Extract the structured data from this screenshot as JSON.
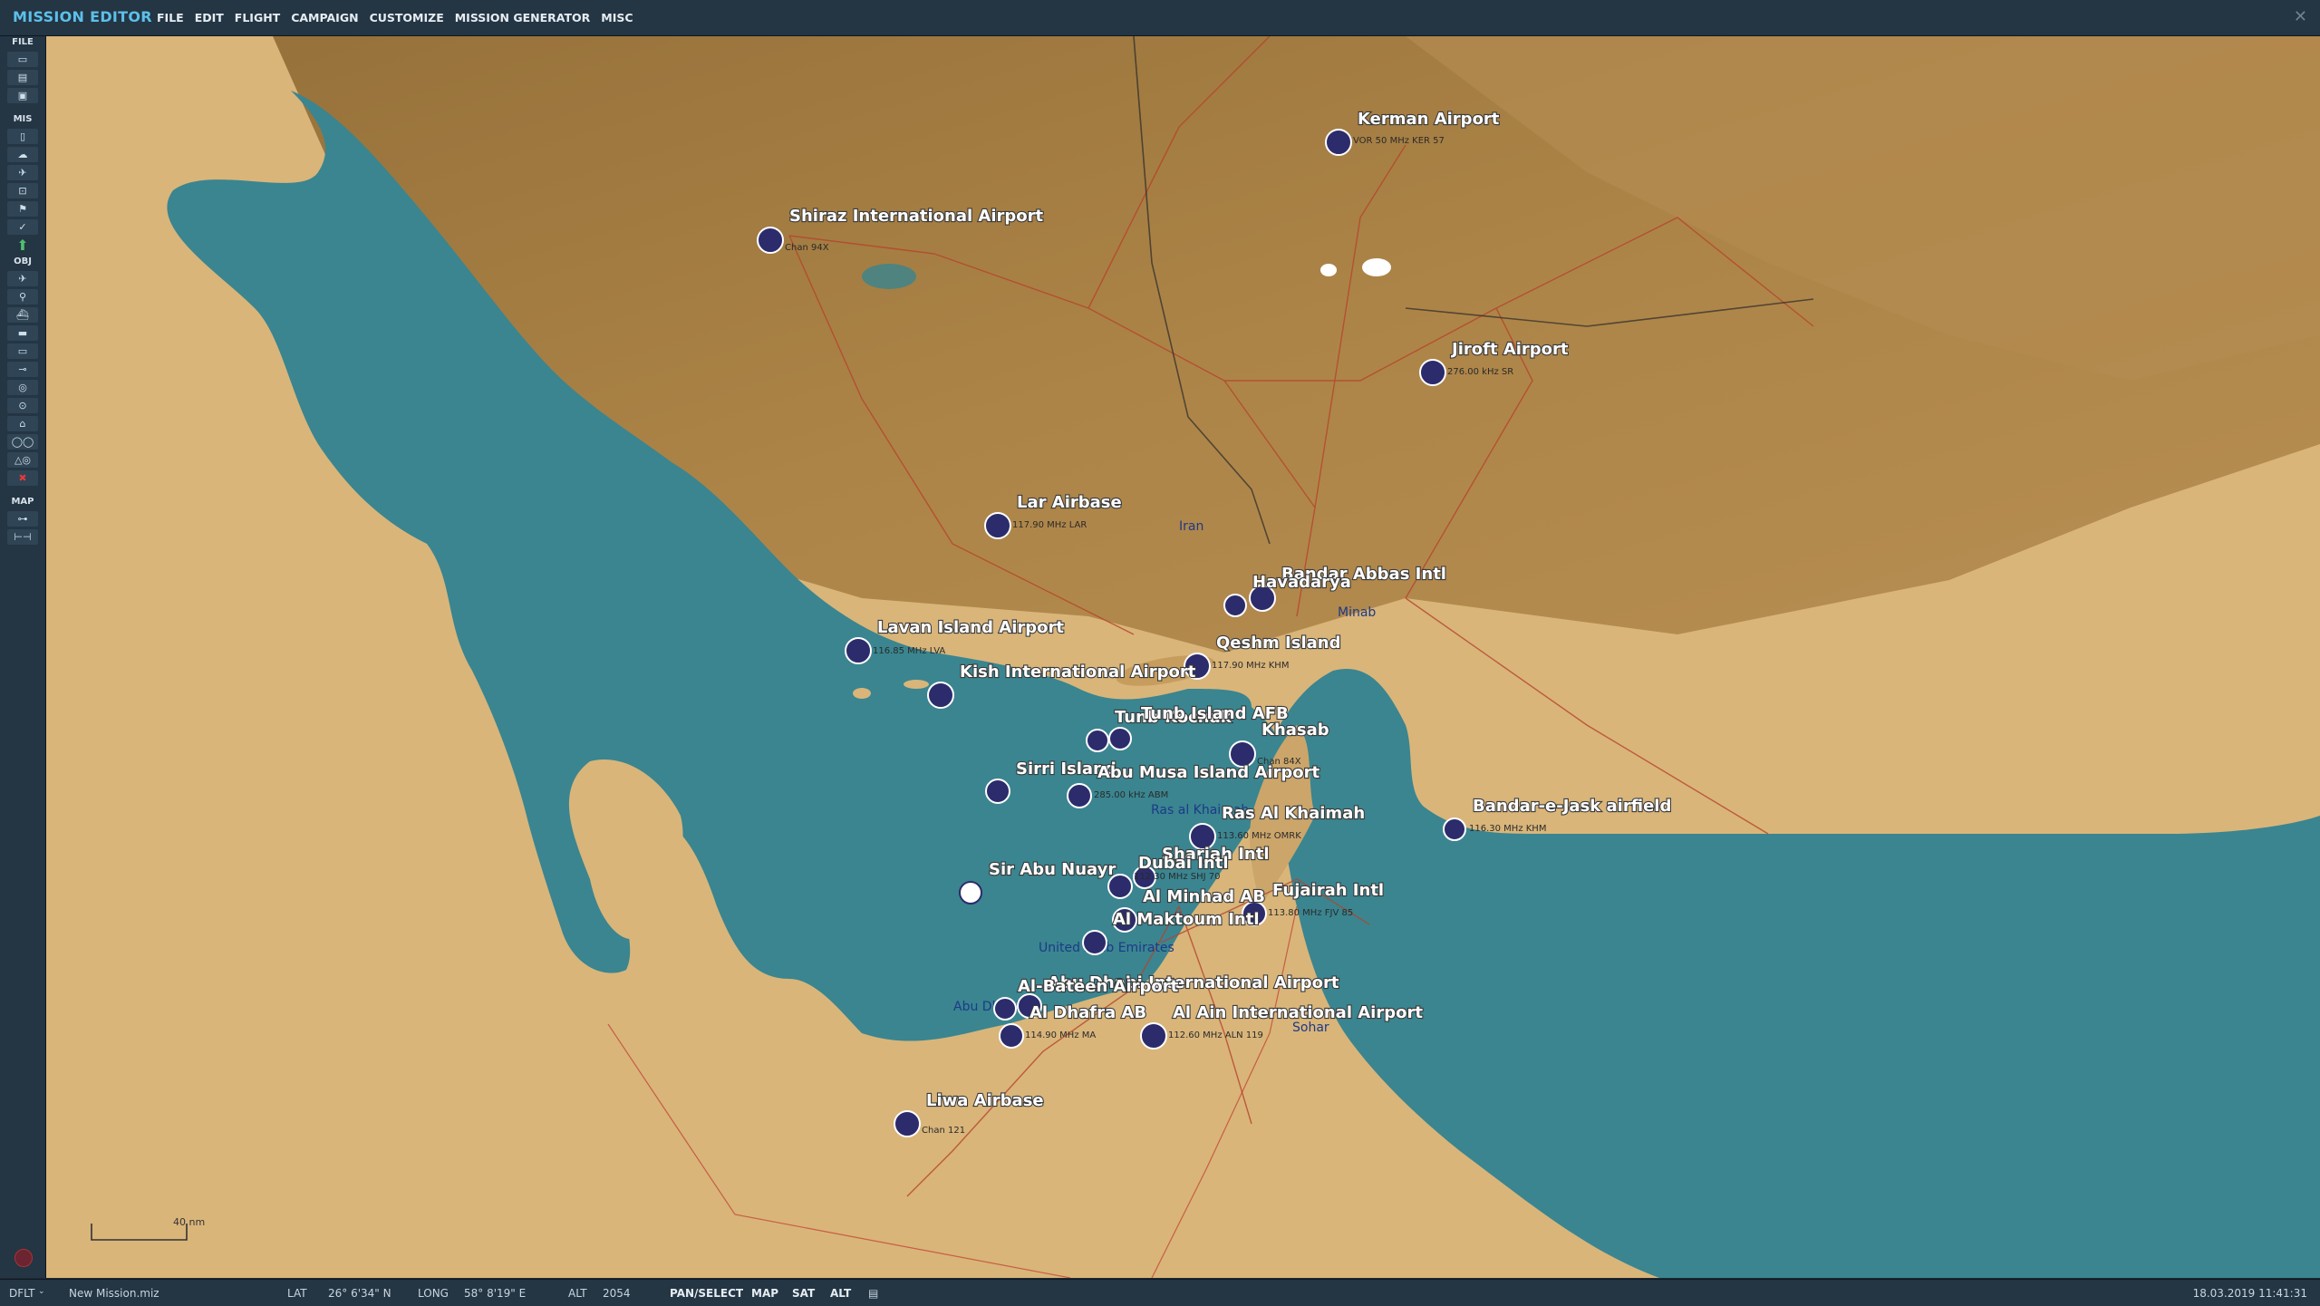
{
  "app": {
    "title": "MISSION EDITOR"
  },
  "menu": [
    "FILE",
    "EDIT",
    "FLIGHT",
    "CAMPAIGN",
    "CUSTOMIZE",
    "MISSION GENERATOR",
    "MISC"
  ],
  "sidebar": {
    "sections": {
      "file": "FILE",
      "mis": "MIS",
      "obj": "OBJ",
      "map": "MAP"
    }
  },
  "map": {
    "airports": [
      {
        "name": "Kerman Airport",
        "freq": "VOR 50 MHz KER 57"
      },
      {
        "name": "Shiraz International Airport",
        "freq": "Chan 94X"
      },
      {
        "name": "Jiroft Airport",
        "freq": "276.00 kHz SR"
      },
      {
        "name": "Lar Airbase",
        "freq": "117.90 MHz LAR"
      },
      {
        "name": "Bandar Abbas Intl",
        "freq": ""
      },
      {
        "name": "Havadarya",
        "freq": ""
      },
      {
        "name": "Lavan Island Airport",
        "freq": "116.85 MHz LVA"
      },
      {
        "name": "Qeshm Island",
        "freq": "117.90 MHz KHM"
      },
      {
        "name": "Kish International Airport",
        "freq": ""
      },
      {
        "name": "Tunb Kochak",
        "freq": ""
      },
      {
        "name": "Tunb Island AFB",
        "freq": ""
      },
      {
        "name": "Khasab",
        "freq": "Chan 84X"
      },
      {
        "name": "Sirri Island",
        "freq": ""
      },
      {
        "name": "Abu Musa Island Airport",
        "freq": "285.00 kHz ABM"
      },
      {
        "name": "Ras Al Khaimah",
        "freq": "113.60 MHz OMRK"
      },
      {
        "name": "Bandar-e-Jask airfield",
        "freq": "116.30 MHz KHM"
      },
      {
        "name": "Sharjah Intl",
        "freq": ""
      },
      {
        "name": "Sir Abu Nuayr",
        "freq": ""
      },
      {
        "name": "Dubai Intl",
        "freq": "112.30 MHz SHJ 70"
      },
      {
        "name": "Fujairah Intl",
        "freq": "113.80 MHz FJV 85"
      },
      {
        "name": "Al Minhad AB",
        "freq": ""
      },
      {
        "name": "Al Maktoum Intl",
        "freq": ""
      },
      {
        "name": "Abu Dhabi International Airport",
        "freq": ""
      },
      {
        "name": "Al-Bateen Airport",
        "freq": ""
      },
      {
        "name": "Al Dhafra AB",
        "freq": "114.90 MHz MA"
      },
      {
        "name": "Al Ain International Airport",
        "freq": "112.60 MHz ALN 119"
      },
      {
        "name": "Liwa Airbase",
        "freq": "Chan 121"
      }
    ],
    "places": [
      "Iran",
      "Minab",
      "United Arab Emirates",
      "Sohar",
      "Abu Dhabi",
      "Ras al Khaimah"
    ],
    "scale_label": "40 nm",
    "colors": {
      "sea": "#3a8590",
      "land": "#d9b57a",
      "mountain": "#9a7338",
      "label_halo": "#3a3a3a"
    }
  },
  "status": {
    "mode": "DFLT",
    "file": "New Mission.miz",
    "lat_label": "LAT",
    "lat": "26° 6'34\" N",
    "long_label": "LONG",
    "long": "58° 8'19\" E",
    "alt_label": "ALT",
    "alt": "2054",
    "pan": "PAN/SELECT",
    "map_btn": "MAP",
    "sat_btn": "SAT",
    "alt_btn": "ALT",
    "datetime": "18.03.2019 11:41:31"
  }
}
